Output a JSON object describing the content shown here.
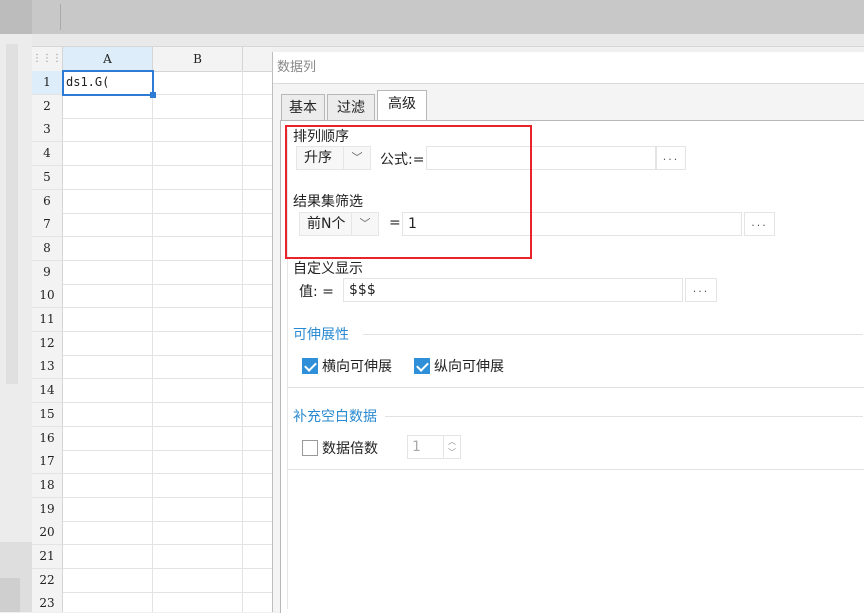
{
  "sheet": {
    "columns": [
      "A",
      "B"
    ],
    "rows": [
      "1",
      "2",
      "3",
      "4",
      "5",
      "6",
      "7",
      "8",
      "9",
      "10",
      "11",
      "12",
      "13",
      "14",
      "15",
      "16",
      "17",
      "18",
      "19",
      "20",
      "21",
      "22",
      "23"
    ],
    "active_cell_value": "ds1.G("
  },
  "dialog": {
    "title": "数据列",
    "tabs": [
      {
        "label": "基本"
      },
      {
        "label": "过滤"
      },
      {
        "label": "高级"
      }
    ],
    "sort": {
      "section_label": "排列顺序",
      "order_value": "升序",
      "formula_label": "公式:=",
      "formula_value": "",
      "browse_label": "..."
    },
    "filter": {
      "section_label": "结果集筛选",
      "mode_value": "前N个",
      "equals_label": "=",
      "value": "1",
      "browse_label": "..."
    },
    "custom_display": {
      "section_label": "自定义显示",
      "value_label": "值:  =",
      "value": "$$$",
      "browse_label": "..."
    },
    "expand": {
      "section_label": "可伸展性",
      "horizontal_label": "横向可伸展",
      "horizontal_checked": true,
      "vertical_label": "纵向可伸展",
      "vertical_checked": true
    },
    "fill_blank": {
      "section_label": "补充空白数据",
      "multiple_label": "数据倍数",
      "multiple_checked": false,
      "multiple_value": "1"
    }
  },
  "colors": {
    "accent_blue": "#2a8ad1",
    "highlight_red": "#e8242a",
    "selection_blue": "#2e7bd6"
  }
}
